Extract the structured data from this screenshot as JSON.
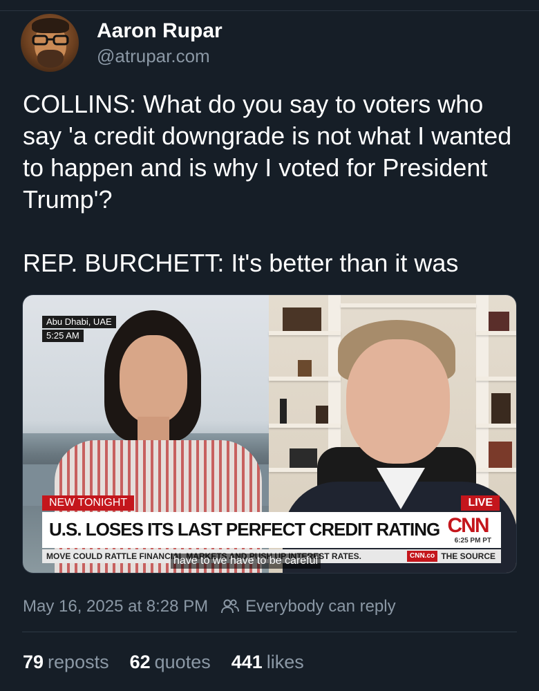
{
  "author": {
    "display_name": "Aaron Rupar",
    "handle": "@atrupar.com"
  },
  "post": {
    "text": "COLLINS: What do you say to voters who say 'a credit downgrade is not what I wanted to happen and is why I voted for President Trump'?\n\nREP. BURCHETT: It's better than it was"
  },
  "video": {
    "location": "Abu Dhabi, UAE",
    "local_time": "5:25 AM",
    "tag_new": "NEW TONIGHT",
    "tag_live": "LIVE",
    "headline": "U.S. LOSES ITS LAST PERFECT CREDIT RATING",
    "network_logo": "CNN",
    "clock": "6:25 PM PT",
    "ticker": "MOVE COULD RATTLE FINANCIAL MARKETS AND PUSH UP INTEREST RATES.",
    "ticker_badge": "CNN.co",
    "show_name": "THE SOURCE",
    "caption": "have to we have to be careful"
  },
  "meta": {
    "timestamp": "May 16, 2025 at 8:28 PM",
    "reply_setting": "Everybody can reply",
    "reply_icon": "people-icon"
  },
  "stats": {
    "reposts_count": "79",
    "reposts_label": "reposts",
    "quotes_count": "62",
    "quotes_label": "quotes",
    "likes_count": "441",
    "likes_label": "likes"
  },
  "colors": {
    "background": "#161e27",
    "muted_text": "#8b98a5",
    "cnn_red": "#c4161c"
  }
}
